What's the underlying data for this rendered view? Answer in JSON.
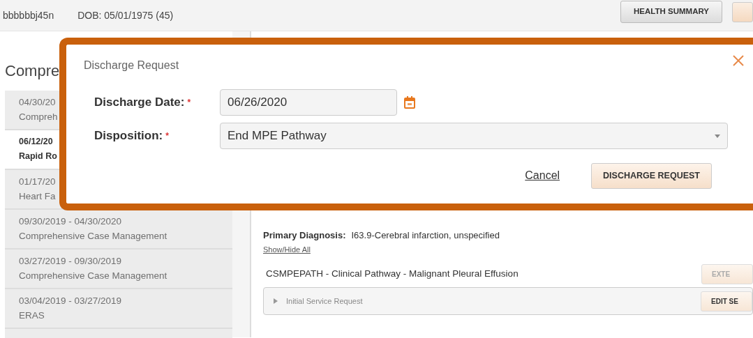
{
  "header": {
    "patient_id": "bbbbbbj45n",
    "dob": "DOB: 05/01/1975 (45)",
    "button": "HEALTH SUMMARY"
  },
  "sidebar": {
    "heading": "Compre",
    "items": [
      {
        "date_range": "04/30/20",
        "program": "Compreh",
        "selected": false
      },
      {
        "date_range": "06/12/20",
        "program": "Rapid Ro",
        "selected": true
      },
      {
        "date_range": "01/17/20",
        "program": "Heart Fa",
        "selected": false
      },
      {
        "date_range": "09/30/2019 - 04/30/2020",
        "program": "Comprehensive Case Management",
        "selected": false
      },
      {
        "date_range": "03/27/2019 - 09/30/2019",
        "program": "Comprehensive Case Management",
        "selected": false
      },
      {
        "date_range": "03/04/2019 - 03/27/2019",
        "program": "ERAS",
        "selected": false
      }
    ]
  },
  "main": {
    "diagnosis_label": "Primary Diagnosis:",
    "diagnosis": "I63.9-Cerebral infarction, unspecified",
    "show_hide": "Show/Hide All",
    "pathway": "CSMPEPATH - Clinical Pathway - Malignant Pleural Effusion",
    "pathway_button": "EXTE",
    "sections": [
      {
        "label": "Initial Service Request",
        "expanded": false,
        "button": "EDIT SE"
      }
    ]
  },
  "dialog": {
    "title": "Discharge Request",
    "fields": [
      {
        "kind": "date",
        "label": "Discharge Date:",
        "required_mark": "*",
        "value": "06/26/2020"
      },
      {
        "kind": "select",
        "label": "Disposition:",
        "required_mark": "*",
        "value": "End MPE Pathway"
      }
    ],
    "cancel": "Cancel",
    "submit": "DISCHARGE REQUEST"
  }
}
